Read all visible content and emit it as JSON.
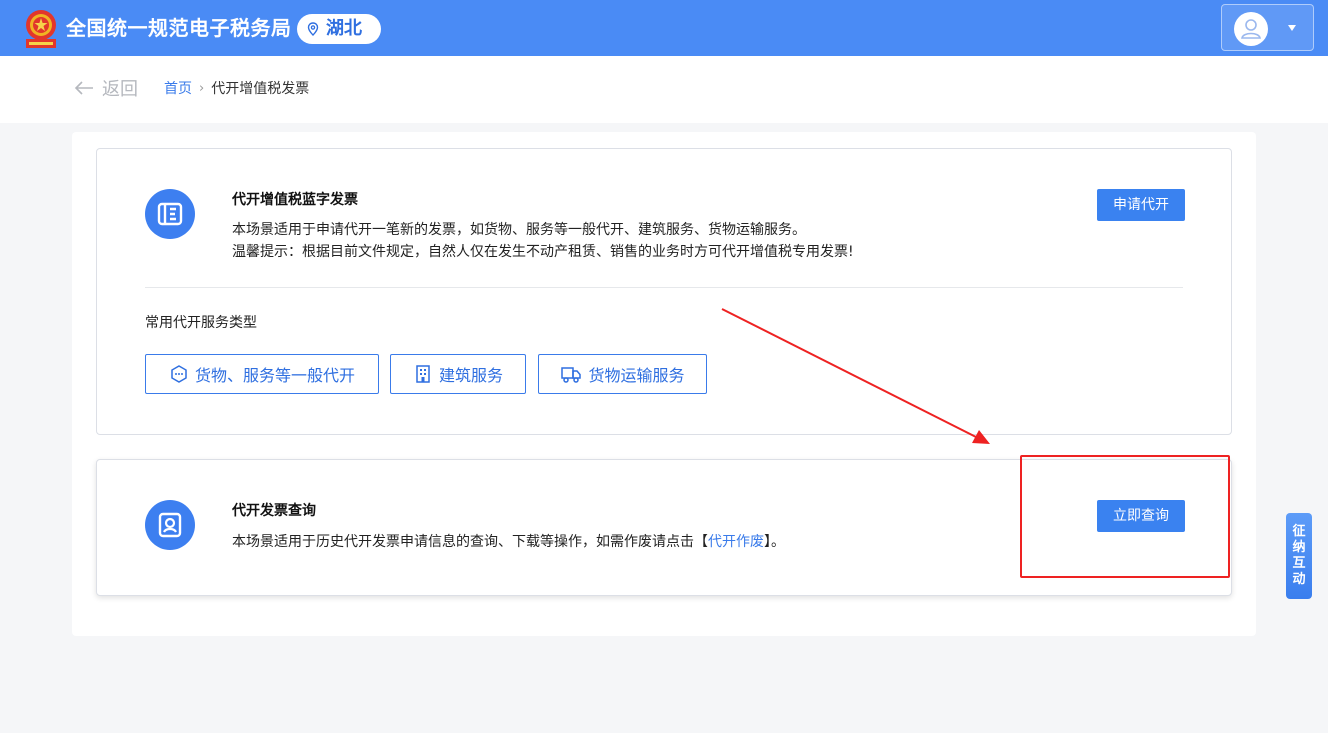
{
  "header": {
    "site_title": "全国统一规范电子税务局",
    "region": "湖北",
    "colors": {
      "bar": "#4a8bf5",
      "accent": "#2f6fe0"
    }
  },
  "breadcrumb": {
    "back_label": "返回",
    "home": "首页",
    "separator": "›",
    "current": "代开增值税发票"
  },
  "card_issue": {
    "icon": "ticket-icon",
    "title": "代开增值税蓝字发票",
    "desc_line1": "本场景适用于申请代开一笔新的发票，如货物、服务等一般代开、建筑服务、货物运输服务。",
    "desc_line2": "温馨提示：根据目前文件规定，自然人仅在发生不动产租赁、销售的业务时方可代开增值税专用发票!",
    "button": "申请代开",
    "types_label": "常用代开服务类型",
    "types": [
      {
        "label": "货物、服务等一般代开",
        "icon": "cube-icon"
      },
      {
        "label": "建筑服务",
        "icon": "building-icon"
      },
      {
        "label": "货物运输服务",
        "icon": "truck-icon"
      }
    ]
  },
  "card_query": {
    "icon": "search-person-icon",
    "title": "代开发票查询",
    "desc_prefix": "本场景适用于历史代开发票申请信息的查询、下载等操作，如需作废请点击【",
    "desc_link": "代开作废",
    "desc_suffix": "】。",
    "button": "立即查询"
  },
  "side_tab": {
    "chars": [
      "征",
      "纳",
      "互",
      "动"
    ]
  }
}
